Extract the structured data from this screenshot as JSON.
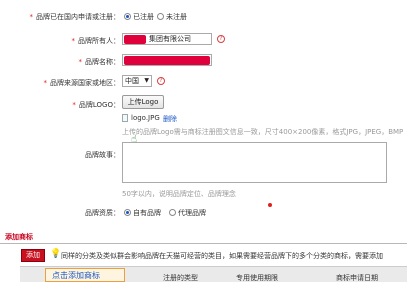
{
  "form": {
    "registered_label": "品牌已在国内申请或注册：",
    "registered_options": [
      "已注册",
      "未注册"
    ],
    "owner_label": "品牌所有人：",
    "owner_value": "集团有限公司",
    "brand_name_label": "品牌名称：",
    "origin_label": "品牌来源国家或地区：",
    "origin_value": "中国",
    "logo_label": "品牌LOGO：",
    "upload_button": "上传Logo",
    "logo_file": "logo.JPG",
    "logo_delete": "删除",
    "logo_hint": "上传的品牌Logo需与商标注册图文信息一致，尺寸400×200像素，格式JPG，JPEG，BMP",
    "story_label": "品牌故事：",
    "story_hint": "50字以内，说明品牌定位、品牌理念",
    "qualification_label": "品牌资质：",
    "qualification_options": [
      "自有品牌",
      "代理品牌"
    ]
  },
  "trademark": {
    "section_title": "添加商标",
    "add_button": "添加",
    "notice": "同样的分类及类似群会影响品牌在天猫可经营的类目，如果需要经营品牌下的多个分类的商标，需要添加",
    "tooltip": "点击添加商标",
    "columns": [
      "注册的类型",
      "专用使用期限",
      "商标申请日期"
    ]
  },
  "colors": {
    "required": "#e02020",
    "accent_red": "#c8101e",
    "link_blue": "#1a57c6"
  }
}
